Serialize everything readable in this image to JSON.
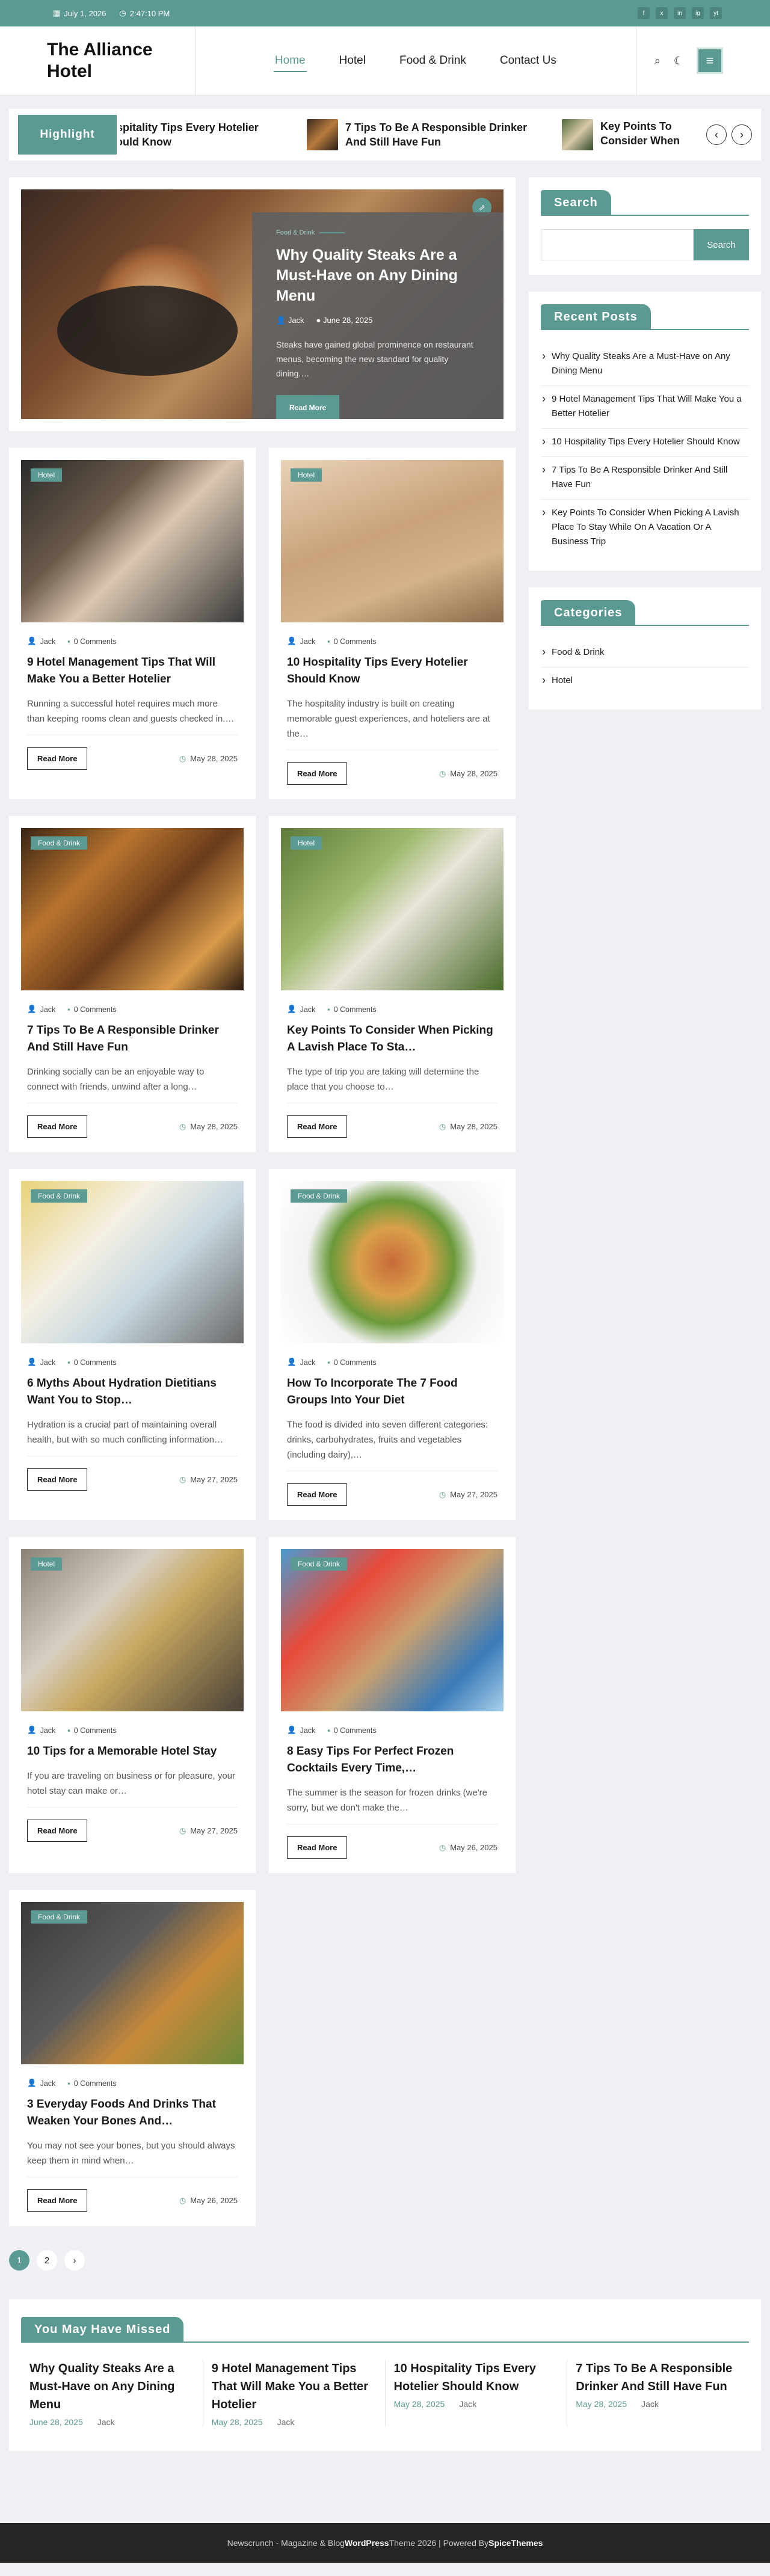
{
  "topbar": {
    "date": "July 1, 2026",
    "time": "2:47:10 PM",
    "social": [
      "f",
      "x",
      "in",
      "ig",
      "yt"
    ]
  },
  "header": {
    "logo": "The Alliance Hotel",
    "nav": [
      "Home",
      "Hotel",
      "Food & Drink",
      "Contact Us"
    ]
  },
  "ticker": {
    "label": "Highlight",
    "items": [
      "Hospitality Tips Every Hotelier Should Know",
      "7 Tips To Be A Responsible Drinker And Still Have Fun",
      "Key Points To Consider When Picking A Lavish Place To Stay"
    ]
  },
  "feature": {
    "category": "Food & Drink",
    "title": "Why Quality Steaks Are a Must-Have on Any Dining Menu",
    "author": "Jack",
    "date": "June 28, 2025",
    "excerpt": "Steaks have gained global prominence on restaurant menus, becoming the new standard for quality dining.…",
    "button": "Read More"
  },
  "posts": [
    {
      "tag": "Hotel",
      "author": "Jack",
      "comments": "0 Comments",
      "title": "9 Hotel Management Tips That Will Make You a Better Hotelier",
      "excerpt": "Running a successful hotel requires much more than keeping rooms clean and guests checked in.…",
      "button": "Read More",
      "date": "May 28, 2025"
    },
    {
      "tag": "Hotel",
      "author": "Jack",
      "comments": "0 Comments",
      "title": "10 Hospitality Tips Every Hotelier Should Know",
      "excerpt": "The hospitality industry is built on creating memorable guest experiences, and hoteliers are at the…",
      "button": "Read More",
      "date": "May 28, 2025"
    },
    {
      "tag": "Food & Drink",
      "author": "Jack",
      "comments": "0 Comments",
      "title": "7 Tips To Be A Responsible Drinker And Still Have Fun",
      "excerpt": "Drinking socially can be an enjoyable way to connect with friends, unwind after a long…",
      "button": "Read More",
      "date": "May 28, 2025"
    },
    {
      "tag": "Hotel",
      "author": "Jack",
      "comments": "0 Comments",
      "title": "Key Points To Consider When Picking A Lavish Place To Sta…",
      "excerpt": "The type of trip you are taking will determine the place that you choose to…",
      "button": "Read More",
      "date": "May 28, 2025"
    },
    {
      "tag": "Food & Drink",
      "author": "Jack",
      "comments": "0 Comments",
      "title": "6 Myths About Hydration Dietitians Want You to Stop…",
      "excerpt": "Hydration is a crucial part of maintaining overall health, but with so much conflicting information…",
      "button": "Read More",
      "date": "May 27, 2025"
    },
    {
      "tag": "Food & Drink",
      "author": "Jack",
      "comments": "0 Comments",
      "title": "How To Incorporate The 7 Food Groups Into Your Diet",
      "excerpt": "The food is divided into seven different categories: drinks, carbohydrates, fruits and vegetables (including dairy),…",
      "button": "Read More",
      "date": "May 27, 2025"
    },
    {
      "tag": "Hotel",
      "author": "Jack",
      "comments": "0 Comments",
      "title": "10 Tips for a Memorable Hotel Stay",
      "excerpt": "If you are traveling on business or for pleasure, your hotel stay can make or…",
      "button": "Read More",
      "date": "May 27, 2025"
    },
    {
      "tag": "Food & Drink",
      "author": "Jack",
      "comments": "0 Comments",
      "title": "8 Easy Tips For Perfect Frozen Cocktails Every Time,…",
      "excerpt": "The summer is the season for frozen drinks (we're sorry, but we don't make the…",
      "button": "Read More",
      "date": "May 26, 2025"
    },
    {
      "tag": "Food & Drink",
      "author": "Jack",
      "comments": "0 Comments",
      "title": "3 Everyday Foods And Drinks That Weaken Your Bones And…",
      "excerpt": "You may not see your bones, but you should always keep them in mind when…",
      "button": "Read More",
      "date": "May 26, 2025"
    }
  ],
  "pagination": {
    "pages": [
      "1",
      "2"
    ],
    "next": "›"
  },
  "sidebar": {
    "search": {
      "title": "Search",
      "button": "Search"
    },
    "recent": {
      "title": "Recent Posts",
      "items": [
        "Why Quality Steaks Are a Must-Have on Any Dining Menu",
        "9 Hotel Management Tips That Will Make You a Better Hotelier",
        "10 Hospitality Tips Every Hotelier Should Know",
        "7 Tips To Be A Responsible Drinker And Still Have Fun",
        "Key Points To Consider When Picking A Lavish Place To Stay While On A Vacation Or A Business Trip"
      ]
    },
    "categories": {
      "title": "Categories",
      "items": [
        "Food & Drink",
        "Hotel"
      ]
    }
  },
  "missed": {
    "title": "You May Have Missed",
    "items": [
      {
        "title": "Why Quality Steaks Are a Must-Have on Any Dining Menu",
        "date": "June 28, 2025",
        "author": "Jack"
      },
      {
        "title": "9 Hotel Management Tips That Will Make You a Better Hotelier",
        "date": "May 28, 2025",
        "author": "Jack"
      },
      {
        "title": "10 Hospitality Tips Every Hotelier Should Know",
        "date": "May 28, 2025",
        "author": "Jack"
      },
      {
        "title": "7 Tips To Be A Responsible Drinker And Still Have Fun",
        "date": "May 28, 2025",
        "author": "Jack"
      }
    ]
  },
  "footer": {
    "text": "Newscrunch - Magazine & Blog ",
    "wp": "WordPress",
    "mid": " Theme 2026 | Powered By ",
    "brand": "SpiceThemes"
  },
  "colors": {
    "accent": "#5b9a92",
    "footer": "#262626"
  }
}
